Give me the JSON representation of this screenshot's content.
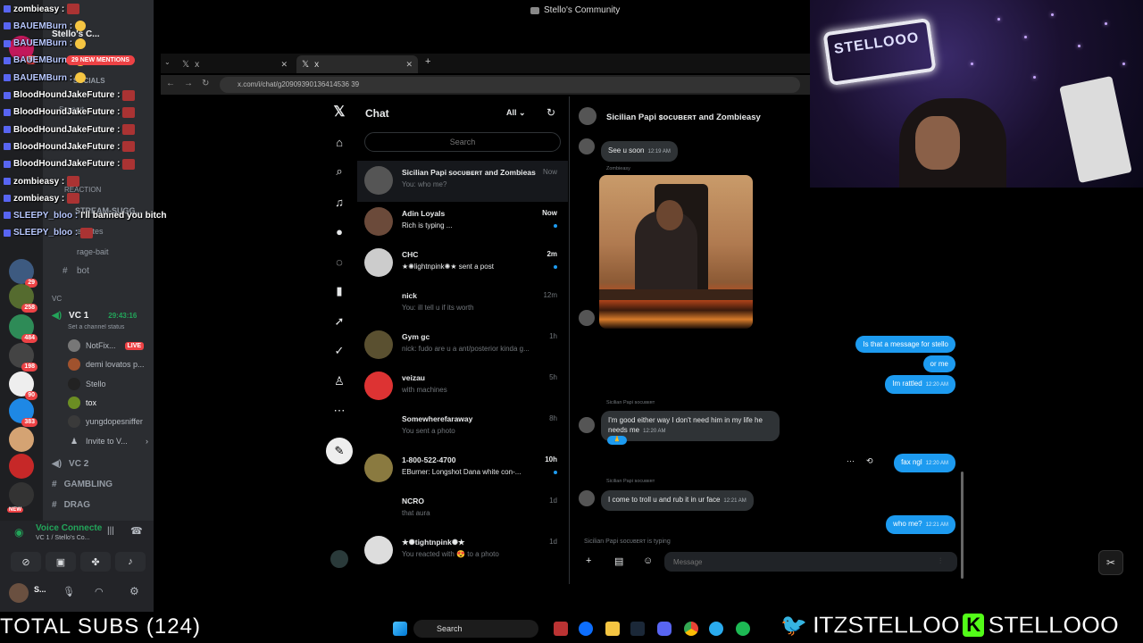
{
  "window": {
    "title": "Stello's Community"
  },
  "browser": {
    "tabs": [
      {
        "label": "x"
      },
      {
        "label": "x"
      }
    ],
    "url": "x.com/i/chat/g20909390136414536 39"
  },
  "discord": {
    "server_name": "Stello's C...",
    "mentions_badge": "29 NEW MENTIONS",
    "server_badges": [
      "64",
      "29",
      "258",
      "484",
      "198",
      "90",
      "383",
      "NEW"
    ],
    "channels": [
      "SOCIALS",
      "Support",
      "REACTION",
      "STREAM-SUGG...",
      "emotes",
      "rage-bait",
      "bot"
    ],
    "voice_category": "VC",
    "vc1": {
      "name": "VC 1",
      "timer": "29:43:16",
      "status": "Set a channel status"
    },
    "vc1_users": [
      {
        "name": "NotFix...",
        "live": "LIVE"
      },
      {
        "name": "demi lovatos p..."
      },
      {
        "name": "Stello"
      },
      {
        "name": "tox"
      },
      {
        "name": "yungdopesniffer"
      },
      {
        "name": "Invite to V..."
      }
    ],
    "other_channels": [
      "VC 2",
      "GAMBLING",
      "DRAG"
    ],
    "voice_connected": {
      "title": "Voice Connecte",
      "subtitle": "VC 1 / Stello's Co..."
    },
    "user_short": "S..."
  },
  "stream_chat": [
    {
      "user": "zombieasy :",
      "emote": "red"
    },
    {
      "user": "BAUEMBurn :",
      "emote": "yellow"
    },
    {
      "user": "BAUEMBurn :",
      "emote": "yellow"
    },
    {
      "user": "BAUEMBurn :",
      "emote": "yellow"
    },
    {
      "user": "BAUEMBurn :",
      "emote": "yellow"
    },
    {
      "user": "BloodHoundJakeFuture :",
      "emote": "red"
    },
    {
      "user": "BloodHoundJakeFuture :",
      "emote": "red"
    },
    {
      "user": "BloodHoundJakeFuture :",
      "emote": "red"
    },
    {
      "user": "BloodHoundJakeFuture :",
      "emote": "red"
    },
    {
      "user": "BloodHoundJakeFuture :",
      "emote": "red"
    },
    {
      "user": "zombieasy :",
      "emote": "red"
    },
    {
      "user": "zombieasy :",
      "emote": "red"
    },
    {
      "user": "SLEEPY_bloo :",
      "text": "I'll banned you bitch"
    },
    {
      "user": "SLEEPY_bloo :",
      "emote": "red"
    }
  ],
  "total_subs": "TOTAL SUBS (124)",
  "x_chat": {
    "heading": "Chat",
    "filter": "All",
    "search_placeholder": "Search",
    "conversations": [
      {
        "name": "Sicilian Papi ꜱᴏᴄᴜʙᴇʀᴛ and Zombieasy",
        "preview": "You: who me?",
        "time": "Now",
        "unread": false,
        "selected": true
      },
      {
        "name": "Adin Loyals",
        "preview": "Rich is typing ...",
        "time": "Now",
        "unread": true
      },
      {
        "name": "CHC",
        "preview": "★✺lightnpink✺★ sent a post",
        "time": "2m",
        "unread": true
      },
      {
        "name": "nick",
        "preview": "You: ill tell u if its worth",
        "time": "12m",
        "unread": false
      },
      {
        "name": "Gym gc",
        "preview": "nick: fudo are u a ant/posterior kinda g...",
        "time": "1h",
        "unread": false
      },
      {
        "name": "veizau",
        "preview": "with machines",
        "time": "5h",
        "unread": false
      },
      {
        "name": "Somewherefaraway",
        "preview": "You sent a photo",
        "time": "8h",
        "unread": false
      },
      {
        "name": "1-800-522-4700",
        "preview": "EBurner: Longshot Dana white con-...",
        "time": "10h",
        "unread": true
      },
      {
        "name": "NCRO",
        "preview": "that aura",
        "time": "1d",
        "unread": false
      },
      {
        "name": "★✺tightnpink✺★",
        "preview": "You reacted with 😍 to a photo",
        "time": "1d",
        "unread": false
      }
    ],
    "conversation_title": "Sicilian Papi ꜱᴏᴄᴜʙᴇʀᴛ and Zombieasy",
    "messages": {
      "m1": {
        "text": "See u soon",
        "time": "12:19 AM"
      },
      "gif_sender": "Zombieasy",
      "out1": {
        "text": "Is that a message for stello"
      },
      "out2": {
        "text": "or me"
      },
      "out3": {
        "text": "Im rattled",
        "time": "12:20 AM"
      },
      "in2_sender": "Sicilian Papi ꜱᴏᴄᴜʙᴇʀᴛ",
      "in2": {
        "text": "I'm good either way I don't need him in my life he needs me",
        "time": "12:20 AM"
      },
      "out4": {
        "text": "fax ngl",
        "time": "12:20 AM"
      },
      "in3_sender": "Sicilian Papi ꜱᴏᴄᴜʙᴇʀᴛ",
      "in3": {
        "text": "I come to troll u and rub it in ur face",
        "time": "12:21 AM"
      },
      "out5": {
        "text": "who me?",
        "time": "12:21 AM"
      }
    },
    "typing": "Sicilian Papi ꜱᴏᴄᴜʙᴇʀᴛ is typing",
    "composer_placeholder": "Message"
  },
  "webcam": {
    "sign_text": "STELLOOO"
  },
  "taskbar": {
    "search_label": "Search"
  },
  "socials": {
    "twitter_handle": "ITZSTELLOO",
    "kick_handle": "STELLOOO",
    "kick_letter": "K"
  },
  "colors": {
    "x_blue": "#1d9bf0",
    "discord_blurple": "#5865f2",
    "kick_green": "#53fc18",
    "twitter_blue": "#1da1f2"
  }
}
